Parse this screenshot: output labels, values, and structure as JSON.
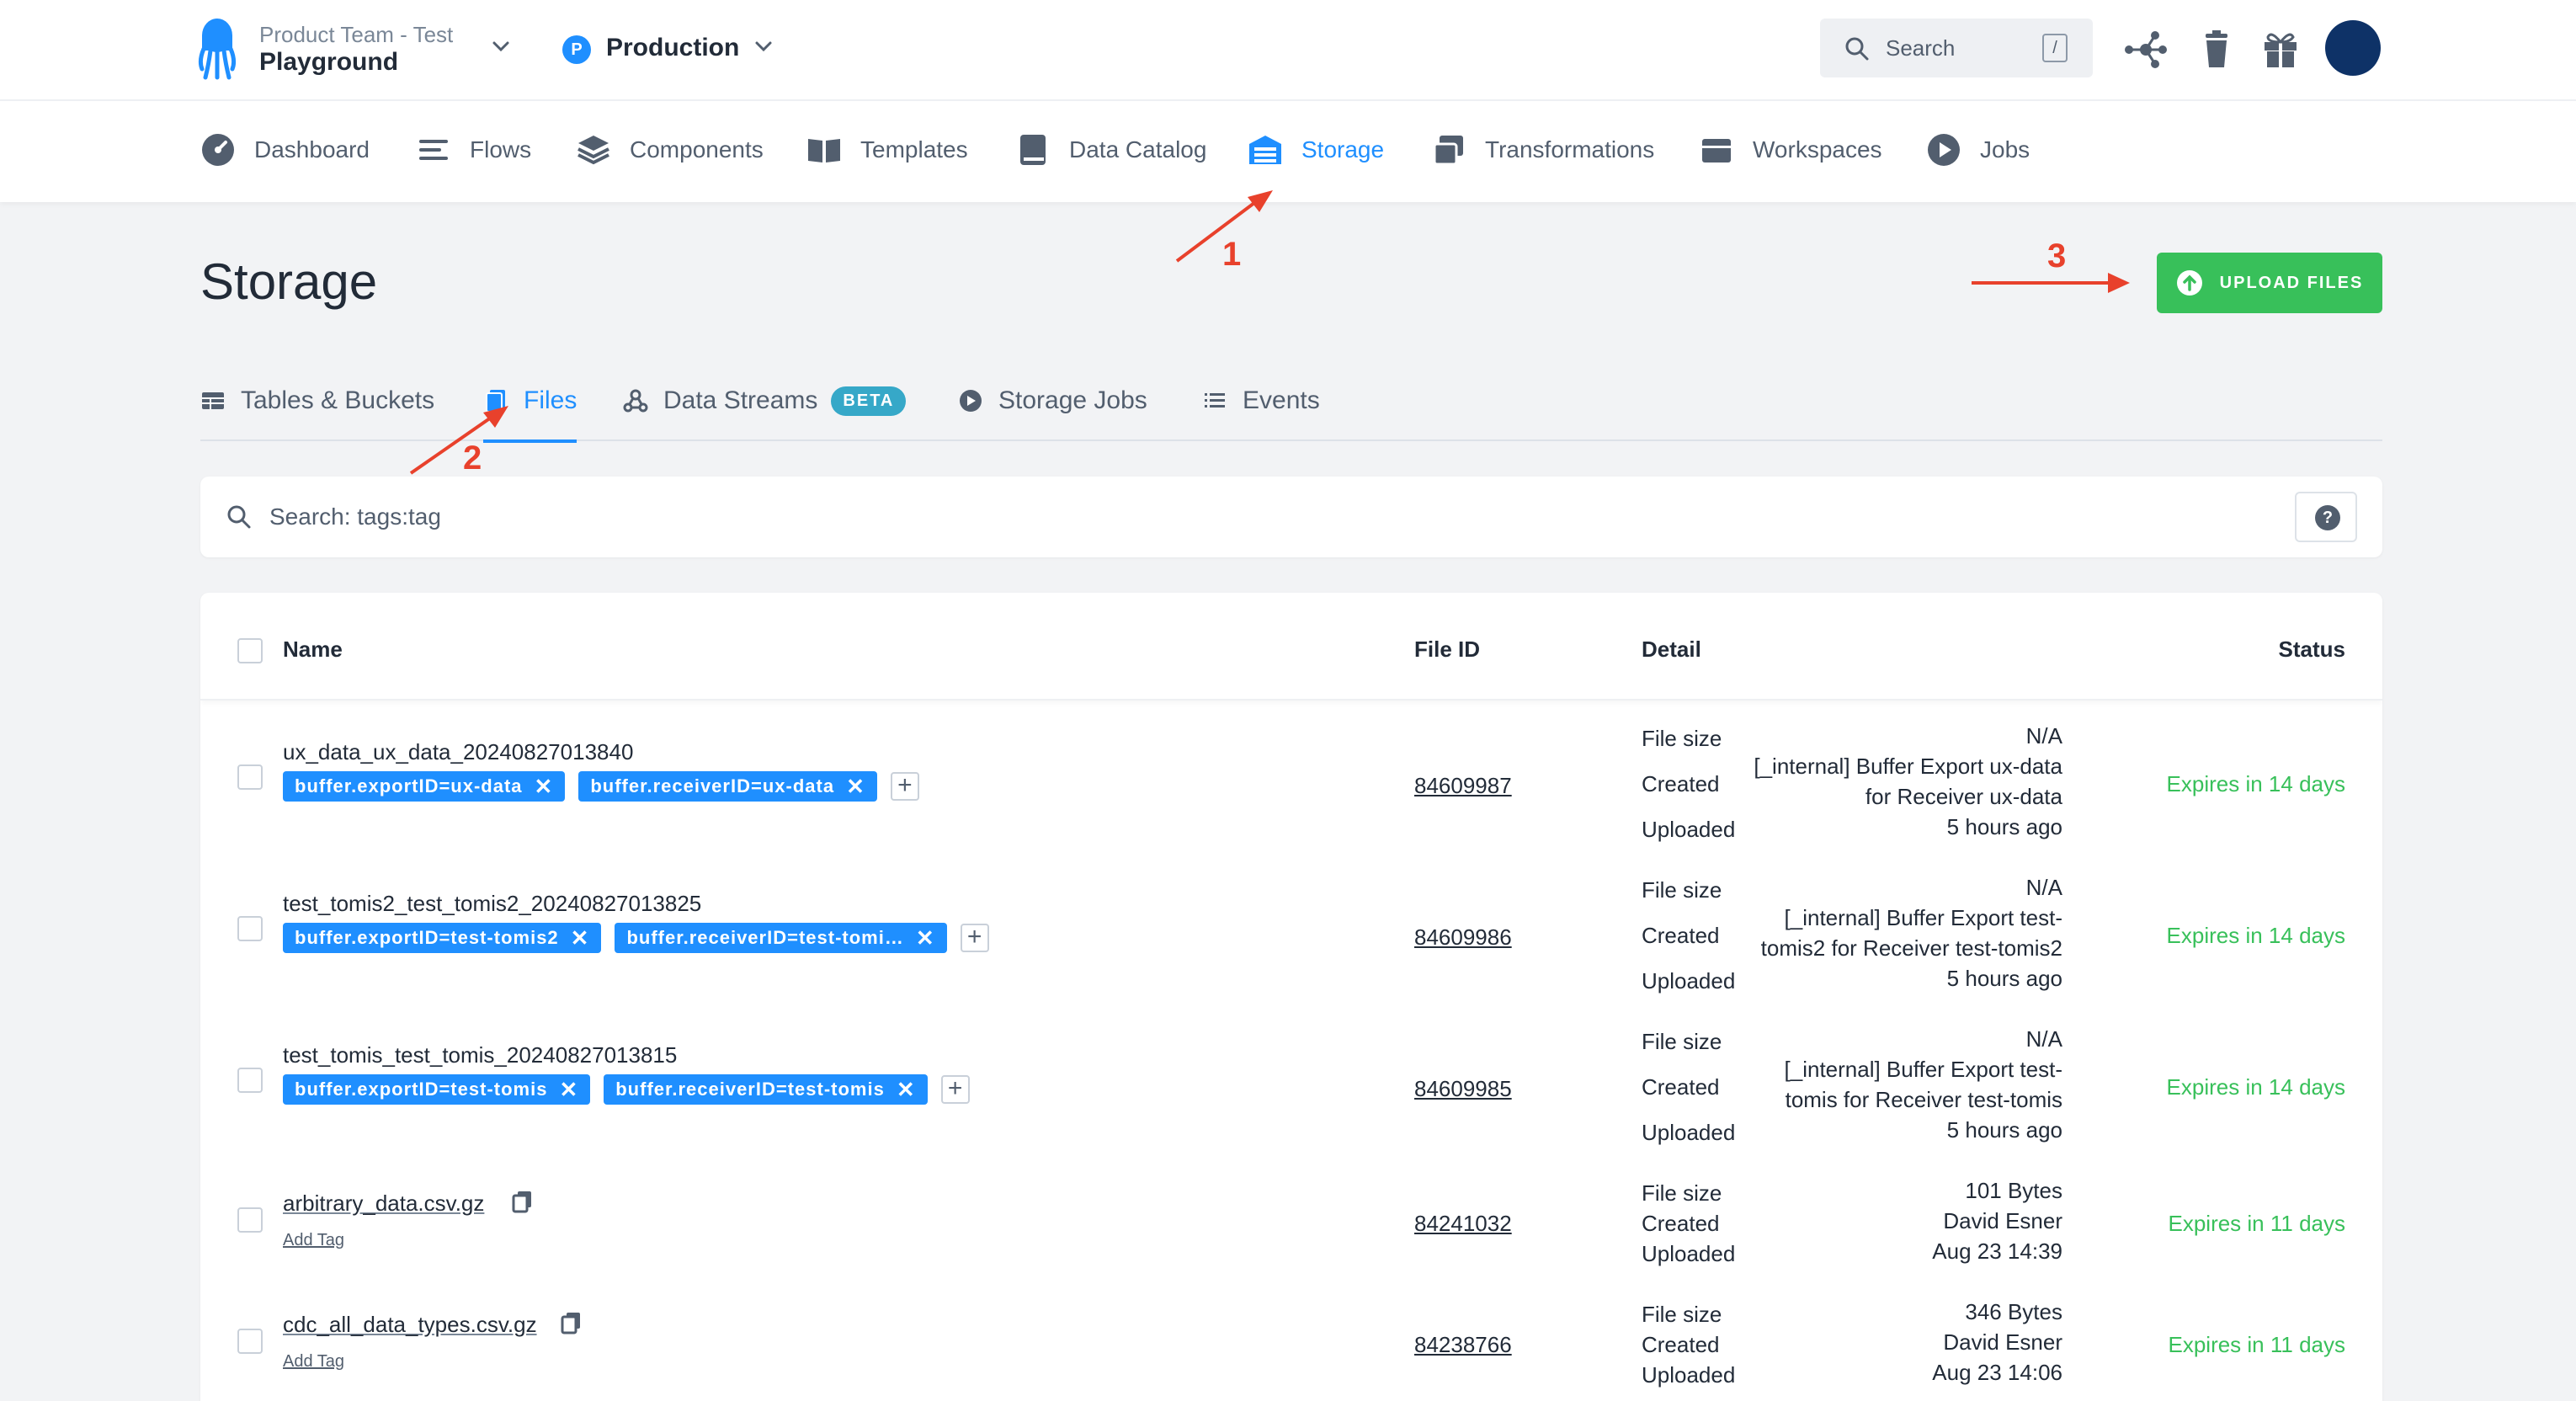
{
  "header": {
    "project_org": "Product Team - Test",
    "project_name": "Playground",
    "env_letter": "P",
    "env_name": "Production",
    "search_label": "Search",
    "search_shortcut": "/"
  },
  "nav": [
    {
      "label": "Dashboard",
      "icon": "dashboard-icon"
    },
    {
      "label": "Flows",
      "icon": "flows-icon"
    },
    {
      "label": "Components",
      "icon": "components-icon"
    },
    {
      "label": "Templates",
      "icon": "templates-icon"
    },
    {
      "label": "Data Catalog",
      "icon": "data-catalog-icon"
    },
    {
      "label": "Storage",
      "icon": "storage-icon",
      "active": true
    },
    {
      "label": "Transformations",
      "icon": "transformations-icon"
    },
    {
      "label": "Workspaces",
      "icon": "workspaces-icon"
    },
    {
      "label": "Jobs",
      "icon": "jobs-icon"
    }
  ],
  "page": {
    "title": "Storage",
    "upload_label": "UPLOAD FILES"
  },
  "tabs": [
    {
      "label": "Tables & Buckets"
    },
    {
      "label": "Files",
      "active": true
    },
    {
      "label": "Data Streams",
      "badge": "BETA"
    },
    {
      "label": "Storage Jobs"
    },
    {
      "label": "Events"
    }
  ],
  "search": {
    "placeholder": "Search: tags:tag"
  },
  "table": {
    "headers": {
      "name": "Name",
      "file_id": "File ID",
      "detail": "Detail",
      "status": "Status"
    },
    "detail_labels": {
      "size": "File size",
      "created": "Created",
      "uploaded": "Uploaded"
    },
    "add_tag_label": "Add Tag",
    "rows": [
      {
        "name": "ux_data_ux_data_20240827013840",
        "tags": [
          "buffer.exportID=ux-data",
          "buffer.receiverID=ux-data"
        ],
        "file_id": "84609987",
        "size": "N/A",
        "created_line1": "[_internal] Buffer Export ux-data",
        "created_line2": "for Receiver ux-data",
        "uploaded": "5 hours ago",
        "status": "Expires in 14 days"
      },
      {
        "name": "test_tomis2_test_tomis2_20240827013825",
        "tags": [
          "buffer.exportID=test-tomis2",
          "buffer.receiverID=test-tomi…"
        ],
        "file_id": "84609986",
        "size": "N/A",
        "created_line1": "[_internal] Buffer Export test-",
        "created_line2": "tomis2 for Receiver test-tomis2",
        "uploaded": "5 hours ago",
        "status": "Expires in 14 days"
      },
      {
        "name": "test_tomis_test_tomis_20240827013815",
        "tags": [
          "buffer.exportID=test-tomis",
          "buffer.receiverID=test-tomis"
        ],
        "file_id": "84609985",
        "size": "N/A",
        "created_line1": "[_internal] Buffer Export test-",
        "created_line2": "tomis for Receiver test-tomis",
        "uploaded": "5 hours ago",
        "status": "Expires in 14 days"
      },
      {
        "name": "arbitrary_data.csv.gz",
        "file_id": "84241032",
        "size": "101 Bytes",
        "created": "David Esner",
        "uploaded": "Aug 23 14:39",
        "status": "Expires in 11 days"
      },
      {
        "name": "cdc_all_data_types.csv.gz",
        "file_id": "84238766",
        "size": "346 Bytes",
        "created": "David Esner",
        "uploaded": "Aug 23 14:06",
        "status": "Expires in 11 days"
      }
    ]
  },
  "annotations": [
    "1",
    "2",
    "3"
  ],
  "colors": {
    "accent": "#1f8fff",
    "success": "#38c05a",
    "annotation": "#e8412c",
    "beta": "#36a8c8"
  }
}
